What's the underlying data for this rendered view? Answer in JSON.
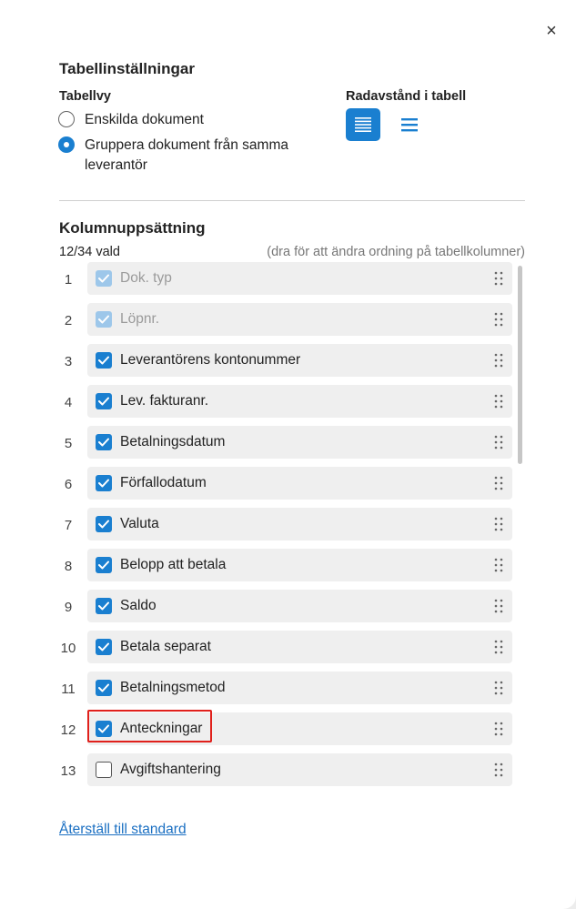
{
  "dialog": {
    "title": "Tabellinställningar",
    "close_label": "×"
  },
  "table_view": {
    "heading": "Tabellvy",
    "options": [
      {
        "label": "Enskilda dokument",
        "selected": false
      },
      {
        "label": "Gruppera dokument från samma leverantör",
        "selected": true
      }
    ]
  },
  "row_spacing": {
    "heading": "Radavstånd i tabell",
    "options": [
      {
        "icon": "compact-lines-icon",
        "active": true
      },
      {
        "icon": "spacious-lines-icon",
        "active": false
      }
    ]
  },
  "columns": {
    "heading": "Kolumnuppsättning",
    "count_text": "12/34 vald",
    "hint": "(dra för att ändra ordning på tabellkolumner)",
    "items": [
      {
        "num": "1",
        "label": "Dok. typ",
        "state": "disabled"
      },
      {
        "num": "2",
        "label": "Löpnr.",
        "state": "disabled"
      },
      {
        "num": "3",
        "label": "Leverantörens kontonummer",
        "state": "on"
      },
      {
        "num": "4",
        "label": "Lev. fakturanr.",
        "state": "on"
      },
      {
        "num": "5",
        "label": "Betalningsdatum",
        "state": "on"
      },
      {
        "num": "6",
        "label": "Förfallodatum",
        "state": "on"
      },
      {
        "num": "7",
        "label": "Valuta",
        "state": "on"
      },
      {
        "num": "8",
        "label": "Belopp att betala",
        "state": "on"
      },
      {
        "num": "9",
        "label": "Saldo",
        "state": "on"
      },
      {
        "num": "10",
        "label": "Betala separat",
        "state": "on"
      },
      {
        "num": "11",
        "label": "Betalningsmetod",
        "state": "on"
      },
      {
        "num": "12",
        "label": "Anteckningar",
        "state": "on"
      },
      {
        "num": "13",
        "label": "Avgiftshantering",
        "state": "off"
      },
      {
        "num": "",
        "label": "",
        "state": "partial"
      }
    ]
  },
  "footer": {
    "reset_label": "Återställ till standard"
  },
  "colors": {
    "accent": "#1a7fd0",
    "highlight": "#e0201b"
  }
}
